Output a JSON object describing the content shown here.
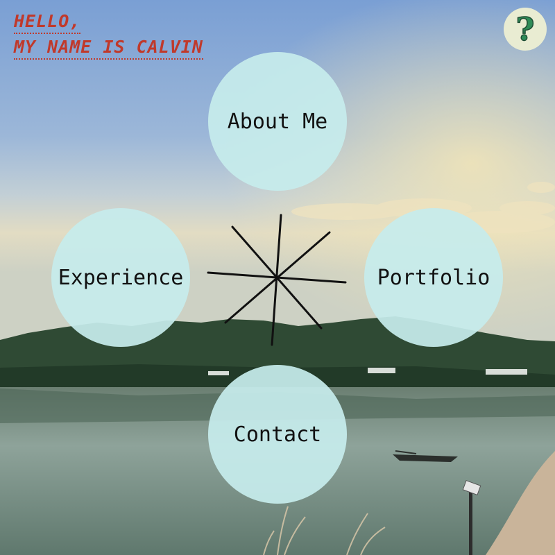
{
  "header": {
    "greeting_line1": "HELLO,",
    "greeting_line2": "MY NAME IS CALVIN"
  },
  "help": {
    "glyph": "?",
    "icon": "question-mark-icon"
  },
  "nav": {
    "about": "About Me",
    "experience": "Experience",
    "portfolio": "Portfolio",
    "contact": "Contact"
  },
  "colors": {
    "greeting_text": "#c0392b",
    "nav_circle_fill": "#c6ecec",
    "help_button_bg": "#e9ecd2",
    "help_glyph": "#2e8b57"
  },
  "background": {
    "description_icon": "lakeside-sunset-photo"
  }
}
